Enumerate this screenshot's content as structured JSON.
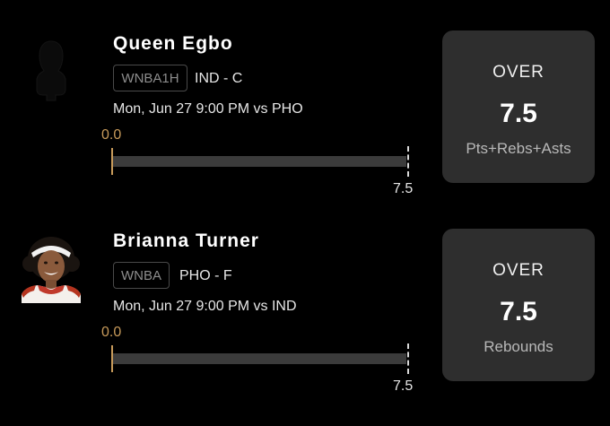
{
  "projections": [
    {
      "player_name": "Queen Egbo",
      "league_badge": "WNBA1H",
      "team_position": "IND - C",
      "game_time": "Mon, Jun 27 9:00 PM  vs PHO",
      "progress_start": "0.0",
      "progress_target": "7.5",
      "progress_value": 0,
      "avatar_icon": "player-silhouette-icon",
      "line_direction": "OVER",
      "line_value": "7.5",
      "line_stat": "Pts+Rebs+Asts"
    },
    {
      "player_name": "Brianna Turner",
      "league_badge": "WNBA",
      "team_position": "PHO - F",
      "game_time": "Mon, Jun 27 9:00 PM  vs IND",
      "progress_start": "0.0",
      "progress_target": "7.5",
      "progress_value": 0,
      "avatar_icon": "player-headshot",
      "line_direction": "OVER",
      "line_value": "7.5",
      "line_stat": "Rebounds"
    }
  ],
  "colors": {
    "background": "#000000",
    "accent": "#c79a5a",
    "line_box": "#2e2e2e",
    "track": "#3b3b3b"
  }
}
